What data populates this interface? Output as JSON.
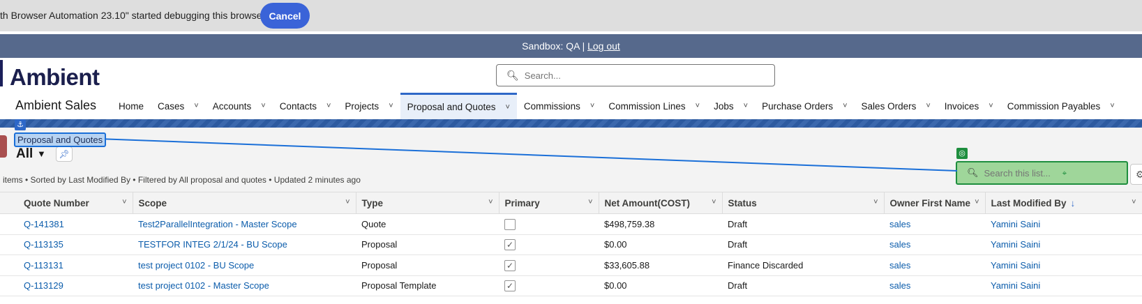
{
  "debug_bar": {
    "message": "th Browser Automation 23.10\" started debugging this browser",
    "cancel_label": "Cancel"
  },
  "sandbox_bar": {
    "text": "Sandbox: QA |",
    "logout_label": "Log out"
  },
  "header": {
    "logo": "Ambient",
    "search_placeholder": "Search..."
  },
  "app": {
    "name": "Ambient Sales",
    "nav": [
      {
        "label": "Home",
        "has_menu": false
      },
      {
        "label": "Cases",
        "has_menu": true
      },
      {
        "label": "Accounts",
        "has_menu": true
      },
      {
        "label": "Contacts",
        "has_menu": true
      },
      {
        "label": "Projects",
        "has_menu": true
      },
      {
        "label": "Proposal and Quotes",
        "has_menu": true,
        "active": true
      },
      {
        "label": "Commissions",
        "has_menu": true
      },
      {
        "label": "Commission Lines",
        "has_menu": true
      },
      {
        "label": "Jobs",
        "has_menu": true
      },
      {
        "label": "Purchase Orders",
        "has_menu": true
      },
      {
        "label": "Sales Orders",
        "has_menu": true
      },
      {
        "label": "Invoices",
        "has_menu": true
      },
      {
        "label": "Commission Payables",
        "has_menu": true
      }
    ]
  },
  "list_view": {
    "object_label": "Proposal and Quotes",
    "view_name": "All",
    "info": "items • Sorted by Last Modified By • Filtered by All proposal and quotes • Updated 2 minutes ago",
    "search_placeholder": "Search this list...",
    "columns": [
      "Quote Number",
      "Scope",
      "Type",
      "Primary",
      "Net Amount(COST)",
      "Status",
      "Owner First Name",
      "Last Modified By"
    ],
    "rows": [
      {
        "quote": "Q-141381",
        "scope": "Test2ParallelIntegration - Master Scope",
        "type": "Quote",
        "primary": false,
        "amount": "$498,759.38",
        "status": "Draft",
        "owner": "sales",
        "modified_by": "Yamini Saini"
      },
      {
        "quote": "Q-113135",
        "scope": "TESTFOR INTEG 2/1/24 - BU Scope",
        "type": "Proposal",
        "primary": true,
        "amount": "$0.00",
        "status": "Draft",
        "owner": "sales",
        "modified_by": "Yamini Saini"
      },
      {
        "quote": "Q-113131",
        "scope": "test project 0102 - BU Scope",
        "type": "Proposal",
        "primary": true,
        "amount": "$33,605.88",
        "status": "Finance Discarded",
        "owner": "sales",
        "modified_by": "Yamini Saini"
      },
      {
        "quote": "Q-113129",
        "scope": "test project 0102 - Master Scope",
        "type": "Proposal Template",
        "primary": true,
        "amount": "$0.00",
        "status": "Draft",
        "owner": "sales",
        "modified_by": "Yamini Saini"
      }
    ]
  },
  "overlay": {
    "anchor_icon": "anchor-icon",
    "target_icon": "target-icon",
    "accent": "#1a6fd8",
    "target_color": "#1e8e3e"
  }
}
